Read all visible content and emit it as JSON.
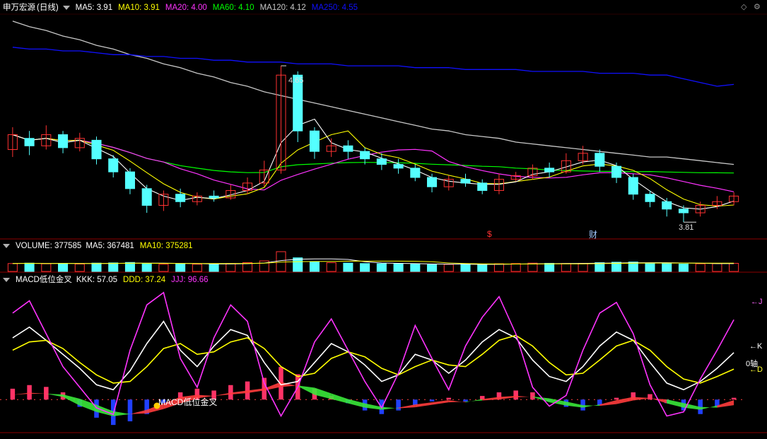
{
  "stock": {
    "name": "申万宏源",
    "period": "(日线)"
  },
  "price_panel": {
    "indicators": [
      {
        "label": "MA5: 3.91",
        "color": "#ffffff"
      },
      {
        "label": "MA10: 3.91",
        "color": "#ffff00"
      },
      {
        "label": "MA20: 4.00",
        "color": "#ff33ff"
      },
      {
        "label": "MA60: 4.10",
        "color": "#00ff00"
      },
      {
        "label": "MA120: 4.12",
        "color": "#c8c8c8"
      },
      {
        "label": "MA250: 4.55",
        "color": "#1010ff"
      }
    ],
    "high_marker": "4.65",
    "low_marker": "3.81",
    "events": [
      "$",
      "财"
    ]
  },
  "volume_panel": {
    "label": "VOLUME: 377585",
    "indicators": [
      {
        "label": "MA5: 367481",
        "color": "#ffffff"
      },
      {
        "label": "MA10: 375281",
        "color": "#ffff00"
      }
    ]
  },
  "macd_panel": {
    "label": "MACD低位金叉",
    "indicators": [
      {
        "label": "KKK: 57.05",
        "color": "#ffffff"
      },
      {
        "label": "DDD: 37.24",
        "color": "#ffff00"
      },
      {
        "label": "JJJ: 96.66",
        "color": "#ff33ff"
      }
    ],
    "right_labels": {
      "j": "J",
      "k": "K",
      "zero": "0轴",
      "d": "D"
    },
    "signal_text": "MACD低位金叉"
  },
  "colors": {
    "up": "#ff3232",
    "down": "#54ffff",
    "ma5": "#ffffff",
    "ma10": "#ffff00",
    "ma20": "#ff33ff",
    "ma60": "#00ff00",
    "ma120": "#c8c8c8",
    "ma250": "#1010ff",
    "border": "#8b0000"
  },
  "chart_data": [
    {
      "type": "candlestick",
      "xlabel": "",
      "ylabel": "",
      "ylim": [
        3.75,
        4.92
      ],
      "series_ma": [
        {
          "name": "MA120",
          "values": [
            4.89,
            4.86,
            4.84,
            4.81,
            4.79,
            4.76,
            4.74,
            4.71,
            4.69,
            4.66,
            4.64,
            4.61,
            4.59,
            4.56,
            4.54,
            4.51,
            4.49,
            4.47,
            4.45,
            4.43,
            4.41,
            4.39,
            4.37,
            4.35,
            4.33,
            4.31,
            4.3,
            4.28,
            4.27,
            4.26,
            4.24,
            4.23,
            4.22,
            4.21,
            4.2,
            4.19,
            4.18,
            4.17,
            4.16,
            4.16,
            4.15,
            4.14,
            4.13,
            4.12
          ]
        },
        {
          "name": "MA250",
          "values": [
            4.75,
            4.74,
            4.74,
            4.73,
            4.73,
            4.72,
            4.71,
            4.71,
            4.7,
            4.7,
            4.69,
            4.69,
            4.68,
            4.68,
            4.67,
            4.67,
            4.67,
            4.66,
            4.66,
            4.66,
            4.65,
            4.65,
            4.65,
            4.65,
            4.64,
            4.64,
            4.64,
            4.63,
            4.63,
            4.63,
            4.63,
            4.62,
            4.62,
            4.62,
            4.62,
            4.61,
            4.61,
            4.61,
            4.6,
            4.6,
            4.58,
            4.56,
            4.54,
            4.55
          ]
        }
      ],
      "candles": [
        [
          4.2,
          4.28,
          4.32,
          4.16
        ],
        [
          4.26,
          4.22,
          4.3,
          4.17
        ],
        [
          4.22,
          4.28,
          4.33,
          4.2
        ],
        [
          4.28,
          4.21,
          4.3,
          4.18
        ],
        [
          4.21,
          4.26,
          4.29,
          4.19
        ],
        [
          4.25,
          4.15,
          4.27,
          4.12
        ],
        [
          4.15,
          4.08,
          4.17,
          4.05
        ],
        [
          4.08,
          3.99,
          4.1,
          3.96
        ],
        [
          3.99,
          3.9,
          4.01,
          3.86
        ],
        [
          3.9,
          3.96,
          3.98,
          3.87
        ],
        [
          3.96,
          3.92,
          3.99,
          3.89
        ],
        [
          3.92,
          3.95,
          3.97,
          3.9
        ],
        [
          3.95,
          3.94,
          3.98,
          3.92
        ],
        [
          3.94,
          3.98,
          4.01,
          3.93
        ],
        [
          3.98,
          4.02,
          4.05,
          3.96
        ],
        [
          4.02,
          4.09,
          4.14,
          4.0
        ],
        [
          4.09,
          4.6,
          4.65,
          4.07
        ],
        [
          4.6,
          4.3,
          4.62,
          4.24
        ],
        [
          4.3,
          4.19,
          4.32,
          4.15
        ],
        [
          4.19,
          4.22,
          4.26,
          4.16
        ],
        [
          4.22,
          4.19,
          4.25,
          4.15
        ],
        [
          4.19,
          4.15,
          4.21,
          4.12
        ],
        [
          4.15,
          4.12,
          4.18,
          4.09
        ],
        [
          4.12,
          4.1,
          4.15,
          4.07
        ],
        [
          4.1,
          4.05,
          4.12,
          4.03
        ],
        [
          4.05,
          4.0,
          4.07,
          3.97
        ],
        [
          4.0,
          4.04,
          4.06,
          3.98
        ],
        [
          4.04,
          4.02,
          4.07,
          4.0
        ],
        [
          4.02,
          3.98,
          4.04,
          3.96
        ],
        [
          3.98,
          4.04,
          4.07,
          3.96
        ],
        [
          4.04,
          4.06,
          4.08,
          4.03
        ],
        [
          4.06,
          4.1,
          4.12,
          4.04
        ],
        [
          4.1,
          4.08,
          4.13,
          4.05
        ],
        [
          4.08,
          4.14,
          4.18,
          4.07
        ],
        [
          4.14,
          4.18,
          4.22,
          4.12
        ],
        [
          4.18,
          4.11,
          4.2,
          4.08
        ],
        [
          4.11,
          4.05,
          4.13,
          4.02
        ],
        [
          4.05,
          3.96,
          4.07,
          3.93
        ],
        [
          3.96,
          3.92,
          3.98,
          3.89
        ],
        [
          3.92,
          3.88,
          3.94,
          3.84
        ],
        [
          3.88,
          3.86,
          3.9,
          3.81
        ],
        [
          3.86,
          3.9,
          3.92,
          3.84
        ],
        [
          3.9,
          3.92,
          3.95,
          3.88
        ],
        [
          3.92,
          3.95,
          3.97,
          3.9
        ]
      ]
    },
    {
      "type": "bar",
      "series": [
        {
          "name": "VOLUME",
          "values": [
            36,
            38,
            35,
            37,
            34,
            38,
            39,
            41,
            37,
            33,
            34,
            33,
            34,
            36,
            40,
            48,
            90,
            62,
            44,
            40,
            38,
            36,
            35,
            36,
            33,
            31,
            32,
            34,
            31,
            35,
            36,
            38,
            37,
            36,
            37,
            40,
            42,
            43,
            38,
            36,
            34,
            35,
            36,
            37
          ]
        }
      ]
    },
    {
      "type": "line",
      "ylim": [
        -35,
        135
      ],
      "series": [
        {
          "name": "KKK",
          "values": [
            75,
            88,
            72,
            55,
            38,
            18,
            12,
            35,
            68,
            95,
            60,
            40,
            65,
            85,
            78,
            45,
            18,
            22,
            45,
            68,
            58,
            42,
            22,
            30,
            55,
            48,
            32,
            48,
            70,
            85,
            75,
            48,
            28,
            22,
            40,
            65,
            82,
            72,
            45,
            20,
            12,
            22,
            38,
            57
          ]
        },
        {
          "name": "DDD",
          "values": [
            60,
            70,
            72,
            62,
            45,
            30,
            20,
            22,
            40,
            62,
            68,
            55,
            58,
            70,
            75,
            62,
            40,
            28,
            32,
            50,
            58,
            52,
            38,
            30,
            40,
            48,
            42,
            40,
            55,
            72,
            78,
            65,
            45,
            30,
            32,
            48,
            65,
            72,
            60,
            40,
            25,
            20,
            28,
            37
          ]
        },
        {
          "name": "JJJ",
          "values": [
            105,
            120,
            80,
            40,
            15,
            -10,
            -18,
            60,
            115,
            130,
            50,
            15,
            75,
            115,
            95,
            20,
            -20,
            15,
            70,
            98,
            60,
            22,
            -10,
            32,
            90,
            50,
            12,
            65,
            100,
            125,
            80,
            15,
            -8,
            5,
            60,
            105,
            118,
            80,
            18,
            -20,
            -15,
            25,
            60,
            97
          ]
        },
        {
          "name": "MACD",
          "values": [
            6,
            8,
            7,
            4,
            -4,
            -10,
            -14,
            -12,
            -8,
            -2,
            4,
            6,
            5,
            8,
            10,
            12,
            18,
            14,
            6,
            2,
            -2,
            -6,
            -8,
            -6,
            -3,
            -1,
            1,
            -1,
            2,
            4,
            5,
            4,
            -1,
            -4,
            -6,
            -3,
            1,
            4,
            3,
            -2,
            -6,
            -8,
            -4,
            1
          ]
        }
      ]
    }
  ]
}
